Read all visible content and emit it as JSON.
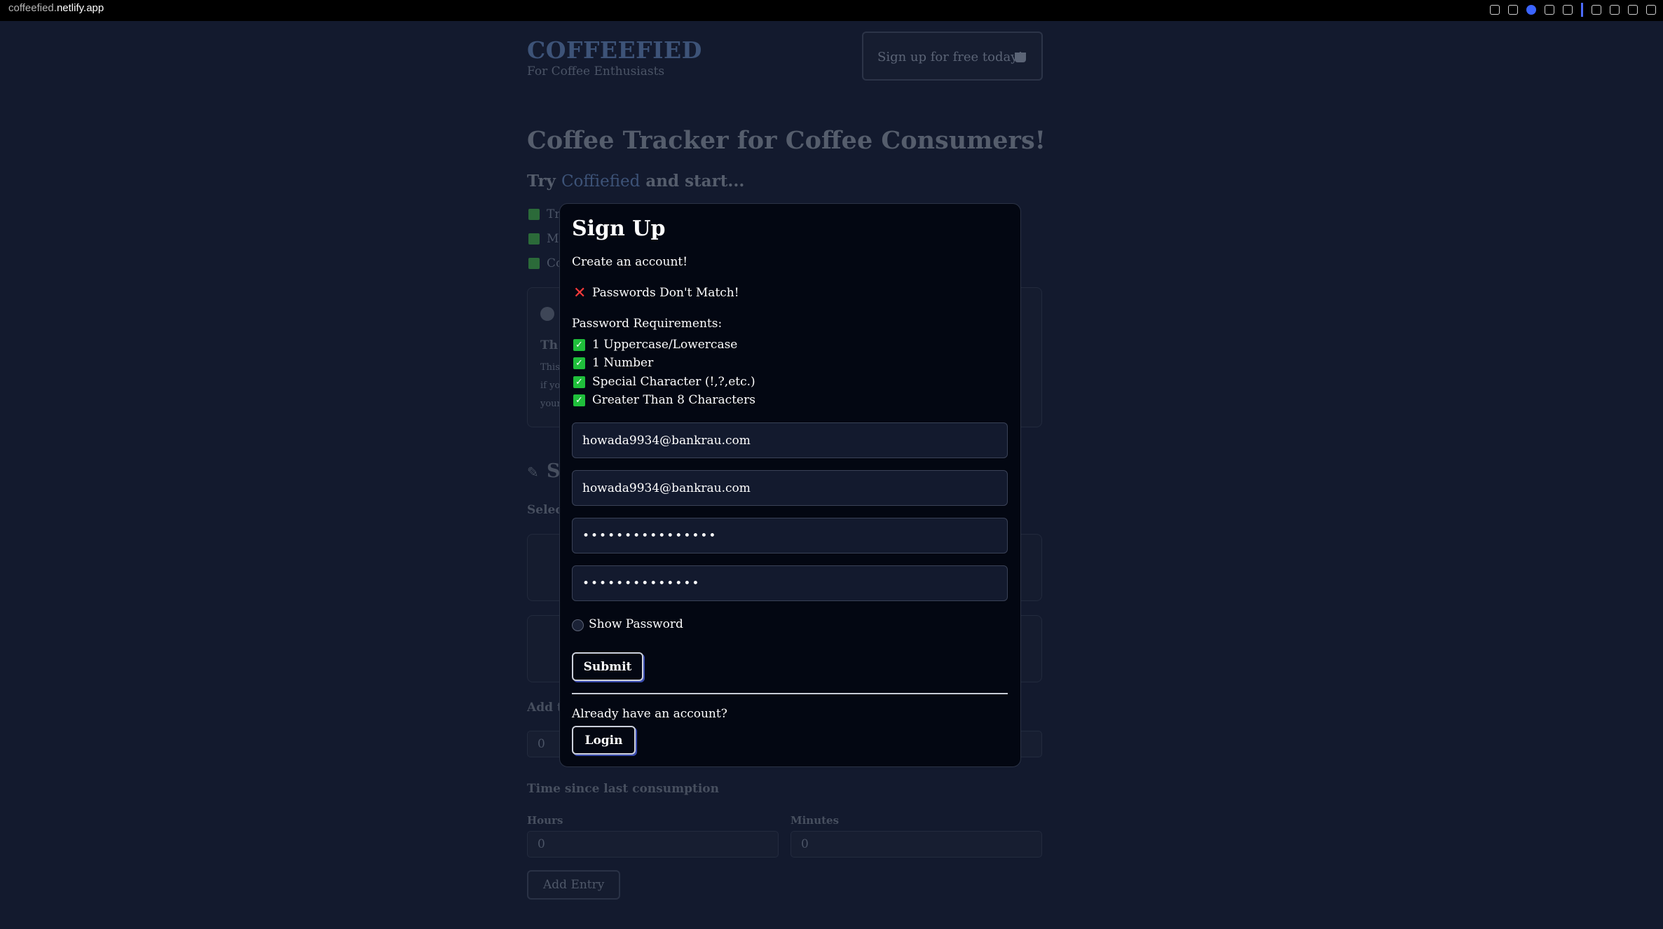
{
  "browser": {
    "url_prefix": "coffeefied.",
    "url_domain": "netlify.app",
    "toolbar_icons": [
      "edit-icon",
      "camera-icon",
      "shield-icon",
      "play-icon",
      "heart-icon",
      "cube-icon",
      "user-icon",
      "download-icon",
      "menu-icon"
    ]
  },
  "background": {
    "logo": "COFFEEFIED",
    "tagline": "For Coffee Enthusiasts",
    "signup_cta": "Sign up for free today!",
    "headline": "Coffee Tracker for Coffee Consumers!",
    "try_prefix": "Try ",
    "try_brand": "Coffiefied",
    "try_suffix": " and start...",
    "feature_items": [
      "Tr",
      "M",
      "Co"
    ],
    "info_title": "Th",
    "info_lines": [
      "This",
      "if yo",
      "your"
    ],
    "section_title": "S",
    "select_label": "Selec",
    "add_label": "Add t",
    "add_value": "0",
    "time_label": "Time since last consumption",
    "hours_label": "Hours",
    "minutes_label": "Minutes",
    "hours_value": "0",
    "minutes_value": "0",
    "add_entry": "Add Entry"
  },
  "modal": {
    "title": "Sign Up",
    "subtitle": "Create an account!",
    "error": "Passwords Don't Match!",
    "requirements_title": "Password Requirements:",
    "requirements": [
      "1 Uppercase/Lowercase",
      "1 Number",
      "Special Character (!,?,etc.)",
      "Greater Than 8 Characters"
    ],
    "email_value": "howada9934@bankrau.com",
    "confirm_email_value": "howada9934@bankrau.com",
    "password_value": "••••••••••••••••",
    "confirm_password_value": "••••••••••••••",
    "show_password_label": "Show Password",
    "submit_label": "Submit",
    "already_text": "Already have an account?",
    "login_label": "Login"
  },
  "colors": {
    "background": "#131a2e",
    "modal_bg": "#030712",
    "check_green": "#1fbf3b",
    "error_red": "#ff3b3b",
    "button_shadow": "#3a4cae"
  }
}
